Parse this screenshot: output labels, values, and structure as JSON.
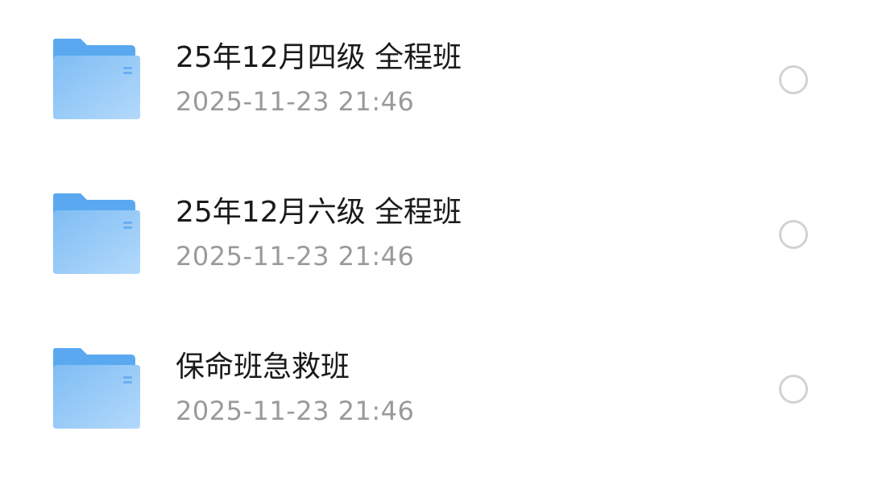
{
  "files": [
    {
      "name": "25年12月四级 全程班",
      "date": "2025-11-23 21:46",
      "icon": "folder-icon",
      "selected": false
    },
    {
      "name": "25年12月六级 全程班",
      "date": "2025-11-23 21:46",
      "icon": "folder-icon",
      "selected": false
    },
    {
      "name": "保命班急救班",
      "date": "2025-11-23 21:46",
      "icon": "folder-icon",
      "selected": false
    }
  ],
  "colors": {
    "folder_back": "#5aa9f0",
    "folder_front_start": "#7fbdf4",
    "folder_front_end": "#b3d9fb",
    "title_text": "#1a1a1a",
    "date_text": "#9a9a9a",
    "radio_border": "#d2d2d2"
  }
}
